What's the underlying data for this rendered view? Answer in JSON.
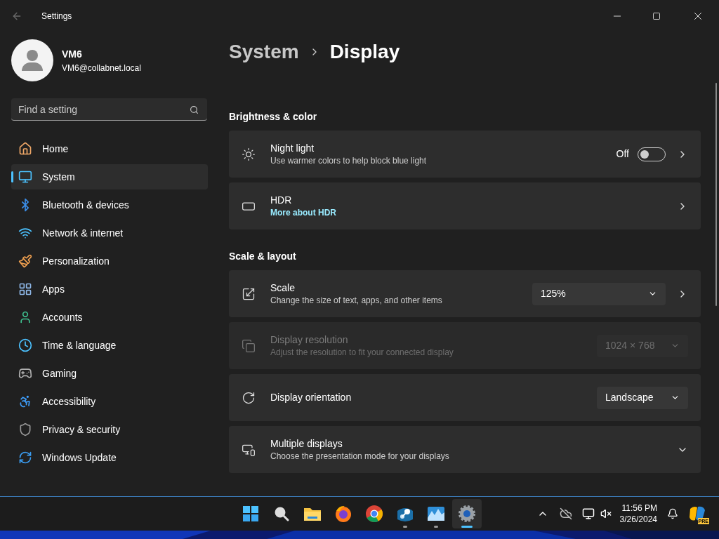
{
  "window": {
    "title": "Settings"
  },
  "user": {
    "name": "VM6",
    "email": "VM6@collabnet.local"
  },
  "search": {
    "placeholder": "Find a setting"
  },
  "sidebar": {
    "items": [
      {
        "label": "Home",
        "selected": false
      },
      {
        "label": "System",
        "selected": true
      },
      {
        "label": "Bluetooth & devices",
        "selected": false
      },
      {
        "label": "Network & internet",
        "selected": false
      },
      {
        "label": "Personalization",
        "selected": false
      },
      {
        "label": "Apps",
        "selected": false
      },
      {
        "label": "Accounts",
        "selected": false
      },
      {
        "label": "Time & language",
        "selected": false
      },
      {
        "label": "Gaming",
        "selected": false
      },
      {
        "label": "Accessibility",
        "selected": false
      },
      {
        "label": "Privacy & security",
        "selected": false
      },
      {
        "label": "Windows Update",
        "selected": false
      }
    ]
  },
  "breadcrumb": {
    "parent": "System",
    "current": "Display"
  },
  "sections": [
    {
      "title": "Brightness & color",
      "rows": [
        {
          "kind": "toggle",
          "title": "Night light",
          "subtitle": "Use warmer colors to help block blue light",
          "state_label": "Off",
          "on": false,
          "disabled": false
        },
        {
          "kind": "link",
          "title": "HDR",
          "link": "More about HDR",
          "disabled": false
        }
      ]
    },
    {
      "title": "Scale & layout",
      "rows": [
        {
          "kind": "dropdown",
          "title": "Scale",
          "subtitle": "Change the size of text, apps, and other items",
          "value": "125%",
          "chevron": true,
          "disabled": false
        },
        {
          "kind": "dropdown",
          "title": "Display resolution",
          "subtitle": "Adjust the resolution to fit your connected display",
          "value": "1024 × 768",
          "chevron": false,
          "disabled": true
        },
        {
          "kind": "dropdown",
          "title": "Display orientation",
          "value": "Landscape",
          "chevron": false,
          "disabled": false
        },
        {
          "kind": "expand",
          "title": "Multiple displays",
          "subtitle": "Choose the presentation mode for your displays",
          "expanded": false,
          "disabled": false
        }
      ]
    }
  ],
  "taskbar": {
    "apps": [
      {
        "running": false,
        "selected": false
      },
      {
        "running": false,
        "selected": false
      },
      {
        "running": false,
        "selected": false
      },
      {
        "running": false,
        "selected": false
      },
      {
        "running": false,
        "selected": false
      },
      {
        "running": true,
        "selected": false
      },
      {
        "running": true,
        "selected": false
      },
      {
        "running": true,
        "selected": true
      }
    ],
    "time": "11:56 PM",
    "date": "3/26/2024",
    "badge": "PRE"
  }
}
